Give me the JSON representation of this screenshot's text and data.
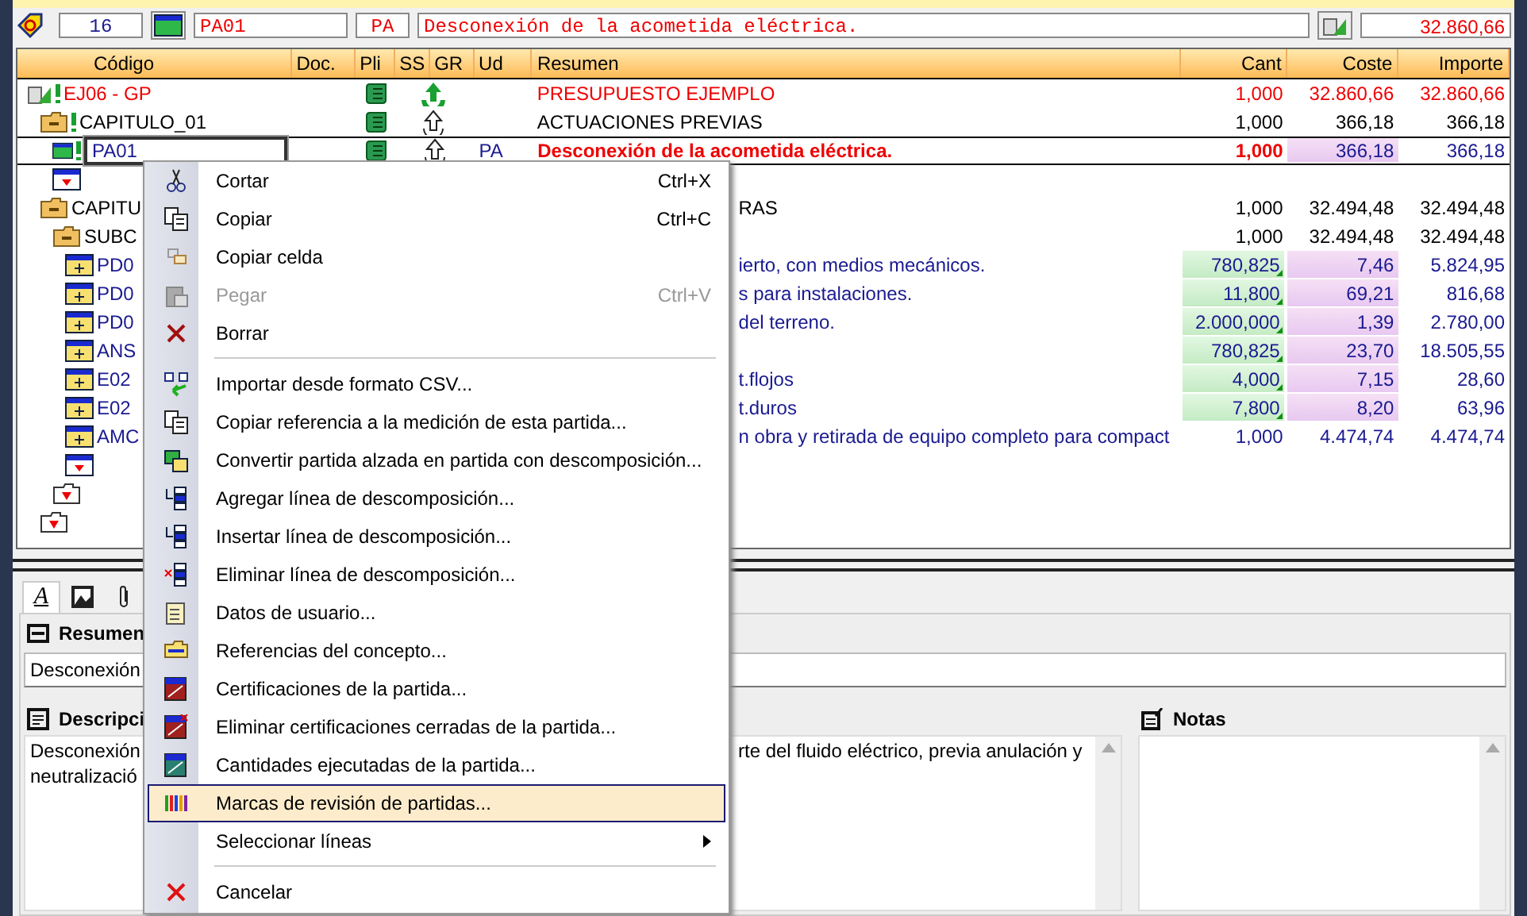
{
  "toolbar": {
    "number": "16",
    "code": "PA01",
    "unit": "PA",
    "summary": "Desconexión de la acometida eléctrica.",
    "total": "32.860,66"
  },
  "table": {
    "columns": [
      "Código",
      "Doc.",
      "Pli",
      "SS",
      "GR",
      "Ud",
      "Resumen",
      "Cant",
      "Coste",
      "Importe"
    ],
    "rows": [
      {
        "kind": "budget",
        "code": "EJ06 - GP",
        "flag": true,
        "doc": true,
        "recycle_filled": true,
        "summary": "PRESUPUESTO EJEMPLO",
        "cant": "1,000",
        "coste": "32.860,66",
        "importe": "32.860,66",
        "selected": false,
        "children": [
          {
            "kind": "chapter",
            "code": "CAPITULO_01",
            "flag": true,
            "doc": true,
            "recycle_filled": false,
            "summary": "ACTUACIONES PREVIAS",
            "cant": "1,000",
            "coste": "366,18",
            "importe": "366,18",
            "selected": false,
            "children": [
              {
                "kind": "lump",
                "code": "PA01",
                "flag": true,
                "doc": true,
                "recycle_filled": false,
                "unit": "PA",
                "summary": "Desconexión de la acometida eléctrica.",
                "cant": "1,000",
                "coste": "366,18",
                "importe": "366,18",
                "coste_shaded": true,
                "selected": true
              },
              {
                "kind": "new_line",
                "selected": false
              }
            ]
          },
          {
            "kind": "chapter",
            "code": "CAPITU",
            "summary": "RAS",
            "cant": "1,000",
            "coste": "32.494,48",
            "importe": "32.494,48",
            "selected": false,
            "children": [
              {
                "kind": "chapter",
                "code": "SUBC",
                "cant": "1,000",
                "coste": "32.494,48",
                "importe": "32.494,48",
                "selected": false,
                "children": [
                  {
                    "kind": "item",
                    "code": "PD0",
                    "summary": "ierto, con medios mecánicos.",
                    "cant": "780,825",
                    "coste": "7,46",
                    "importe": "5.824,95",
                    "cant_shaded": true,
                    "coste_shaded": true,
                    "selected": false
                  },
                  {
                    "kind": "item",
                    "code": "PD0",
                    "summary": "s para instalaciones.",
                    "cant": "11,800",
                    "coste": "69,21",
                    "importe": "816,68",
                    "cant_shaded": true,
                    "coste_shaded": true,
                    "selected": false
                  },
                  {
                    "kind": "item",
                    "code": "PD0",
                    "summary": "del terreno.",
                    "cant": "2.000,000",
                    "coste": "1,39",
                    "importe": "2.780,00",
                    "cant_shaded": true,
                    "coste_shaded": true,
                    "selected": false
                  },
                  {
                    "kind": "item",
                    "code": "ANS",
                    "cant": "780,825",
                    "coste": "23,70",
                    "importe": "18.505,55",
                    "cant_shaded": true,
                    "coste_shaded": true,
                    "selected": false
                  },
                  {
                    "kind": "item",
                    "code": "E02",
                    "summary": "t.flojos",
                    "cant": "4,000",
                    "coste": "7,15",
                    "importe": "28,60",
                    "cant_shaded": true,
                    "coste_shaded": true,
                    "selected": false
                  },
                  {
                    "kind": "item",
                    "code": "E02",
                    "summary": "t.duros",
                    "cant": "7,800",
                    "coste": "8,20",
                    "importe": "63,96",
                    "cant_shaded": true,
                    "coste_shaded": true,
                    "selected": false
                  },
                  {
                    "kind": "item",
                    "code": "AMC",
                    "summary": "n obra y retirada de equipo completo para compact",
                    "cant": "1,000",
                    "coste": "4.474,74",
                    "importe": "4.474,74",
                    "selected": false
                  },
                  {
                    "kind": "new_line",
                    "selected": false
                  }
                ]
              },
              {
                "kind": "new_chapter",
                "selected": false
              }
            ]
          },
          {
            "kind": "new_chapter",
            "selected": false
          }
        ]
      }
    ]
  },
  "detail_tabs": [
    {
      "icon_text": "A",
      "selected": true
    },
    {
      "selected": false
    },
    {
      "selected": false
    }
  ],
  "resumen": {
    "title": "Resumen",
    "value": "Desconexión"
  },
  "descripcion": {
    "title": "Descripci",
    "line_1_start": "Desconexión",
    "line_2_start": "neutralizació",
    "line_1_end": "rte del fluido eléctrico, previa anulación y"
  },
  "notas": {
    "title": "Notas"
  },
  "context_menu": [
    {
      "kind": "item",
      "label": "Cortar",
      "shortcut": "Ctrl+X",
      "disabled": false,
      "selected": false
    },
    {
      "kind": "item",
      "label": "Copiar",
      "shortcut": "Ctrl+C",
      "disabled": false,
      "selected": false
    },
    {
      "kind": "item",
      "label": "Copiar celda",
      "disabled": false,
      "selected": false
    },
    {
      "kind": "item",
      "label": "Pegar",
      "shortcut": "Ctrl+V",
      "disabled": true,
      "selected": false
    },
    {
      "kind": "item",
      "label": "Borrar",
      "disabled": false,
      "selected": false
    },
    {
      "kind": "separator"
    },
    {
      "kind": "item",
      "label": "Importar desde formato CSV...",
      "disabled": false,
      "selected": false
    },
    {
      "kind": "item",
      "label": "Copiar referencia a la medición de esta partida...",
      "disabled": false,
      "selected": false
    },
    {
      "kind": "item",
      "label": "Convertir partida alzada en partida con descomposición...",
      "disabled": false,
      "selected": false
    },
    {
      "kind": "item",
      "label": "Agregar línea de descomposición...",
      "disabled": false,
      "selected": false
    },
    {
      "kind": "item",
      "label": "Insertar línea de descomposición...",
      "disabled": false,
      "selected": false
    },
    {
      "kind": "item",
      "label": "Eliminar línea de descomposición...",
      "disabled": false,
      "selected": false
    },
    {
      "kind": "item",
      "label": "Datos de usuario...",
      "disabled": false,
      "selected": false
    },
    {
      "kind": "item",
      "label": "Referencias del concepto...",
      "disabled": false,
      "selected": false
    },
    {
      "kind": "item",
      "label": "Certificaciones de la partida...",
      "disabled": false,
      "selected": false
    },
    {
      "kind": "item",
      "label": "Eliminar certificaciones cerradas de la partida...",
      "disabled": false,
      "selected": false
    },
    {
      "kind": "item",
      "label": "Cantidades ejecutadas de la partida...",
      "disabled": false,
      "selected": false
    },
    {
      "kind": "item",
      "label": "Marcas de revisión de partidas...",
      "disabled": false,
      "selected": true
    },
    {
      "kind": "item",
      "label": "Seleccionar líneas",
      "submenu": true,
      "disabled": false,
      "selected": false
    },
    {
      "kind": "separator"
    },
    {
      "kind": "item",
      "label": "Cancelar",
      "disabled": false,
      "selected": false
    }
  ]
}
